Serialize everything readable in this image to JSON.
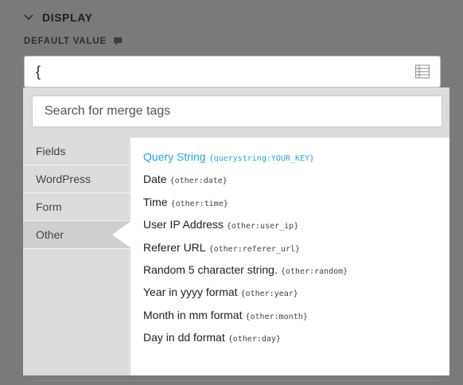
{
  "section": {
    "title": "DISPLAY"
  },
  "default_value": {
    "label": "DEFAULT VALUE",
    "value": "{"
  },
  "merge_tags": {
    "search_placeholder": "Search for merge tags",
    "categories": [
      {
        "label": "Fields"
      },
      {
        "label": "WordPress"
      },
      {
        "label": "Form"
      },
      {
        "label": "Other"
      }
    ],
    "active_category": "Other",
    "tags": [
      {
        "name": "Query String",
        "code": "{querystring:YOUR_KEY}"
      },
      {
        "name": "Date",
        "code": "{other:date}"
      },
      {
        "name": "Time",
        "code": "{other:time}"
      },
      {
        "name": "User IP Address",
        "code": "{other:user_ip}"
      },
      {
        "name": "Referer URL",
        "code": "{other:referer_url}"
      },
      {
        "name": "Random 5 character string.",
        "code": "{other:random}"
      },
      {
        "name": "Year in yyyy format",
        "code": "{other:year}"
      },
      {
        "name": "Month in mm format",
        "code": "{other:month}"
      },
      {
        "name": "Day in dd format",
        "code": "{other:day}"
      }
    ]
  },
  "colors": {
    "backdrop": "#7a7a7c",
    "highlight": "#2fa4d9",
    "panel": "#dcdcdc"
  },
  "icons": {
    "collapse": "chevron-down-icon",
    "help": "speech-bubble-icon",
    "merge_tags": "list-icon"
  }
}
